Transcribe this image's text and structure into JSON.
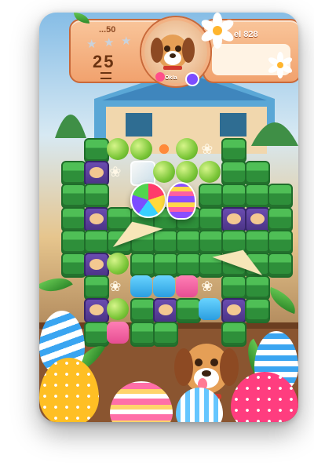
{
  "hud": {
    "score_label": "...50",
    "moves_left": "25",
    "level_label": "el 828",
    "player_tag": "Ok!a"
  },
  "stars": {
    "earned": 0,
    "total": 3
  },
  "board": {
    "rows": 9,
    "cols": 10,
    "tiles": [
      [
        "empty",
        "pot",
        "ball",
        "ball",
        "paw",
        "ball",
        "bone",
        "pot",
        "empty",
        "empty"
      ],
      [
        "pot",
        "hamster",
        "bone",
        "ice",
        "ball",
        "ball",
        "ball",
        "pot",
        "pot",
        "empty"
      ],
      [
        "pot",
        "pot",
        "yarn",
        "yarn",
        "rocket",
        "rocket",
        "pot",
        "pot",
        "pot",
        "pot"
      ],
      [
        "pot",
        "hamster",
        "pot",
        "pot",
        "pot",
        "pot",
        "pot",
        "hamster",
        "hamster",
        "pot"
      ],
      [
        "pot",
        "pot",
        "pot",
        "pot",
        "pot",
        "pot",
        "pot",
        "pot",
        "pot",
        "pot"
      ],
      [
        "pot",
        "hamster",
        "ball",
        "pot",
        "pot",
        "pot",
        "pot",
        "pot",
        "pot",
        "pot"
      ],
      [
        "empty",
        "pot",
        "bone",
        "blue",
        "blue",
        "pink",
        "bone",
        "pot",
        "pot",
        "empty"
      ],
      [
        "empty",
        "hamster",
        "ball",
        "pot",
        "hamster",
        "pot",
        "blue",
        "hamster",
        "pot",
        "empty"
      ],
      [
        "empty",
        "pot",
        "pink",
        "pot",
        "pot",
        "dog",
        "dog",
        "pot",
        "empty",
        "empty"
      ]
    ]
  },
  "colors": {
    "hud_fill": "#f1a26e",
    "hud_border": "#c8693a",
    "pot_green": "#2e8f3a",
    "ball_green": "#7bc638",
    "hamster_purple": "#4b3486"
  },
  "icons": [
    "star-icon",
    "dog-avatar-icon",
    "paw-icon",
    "bone-icon",
    "hamster-icon",
    "yarn-ball-icon",
    "rocket-icon",
    "paper-plane-icon",
    "flower-icon",
    "easter-egg-icon"
  ]
}
